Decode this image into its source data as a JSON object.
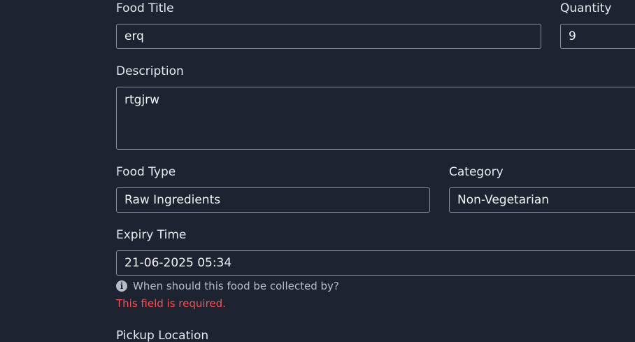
{
  "form": {
    "food_title": {
      "label": "Food Title",
      "value": "erq"
    },
    "quantity": {
      "label": "Quantity",
      "value": "9"
    },
    "description": {
      "label": "Description",
      "value": "rtgjrw"
    },
    "food_type": {
      "label": "Food Type",
      "value": "Raw Ingredients"
    },
    "category": {
      "label": "Category",
      "value": "Non-Vegetarian"
    },
    "expiry_time": {
      "label": "Expiry Time",
      "value": "21-06-2025 05:34",
      "hint": "When should this food be collected by?",
      "hint_icon": "info-icon",
      "error": "This field is required."
    },
    "pickup_location": {
      "label": "Pickup Location"
    }
  },
  "colors": {
    "background": "#1d2331",
    "border": "#8b92a0",
    "error": "#f2555a"
  }
}
